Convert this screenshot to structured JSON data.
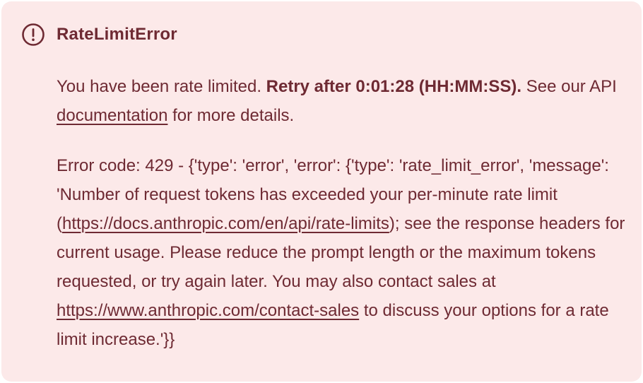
{
  "alert": {
    "icon": "exclamation-circle-icon",
    "colors": {
      "background": "#fce9e9",
      "text": "#6e2a33"
    },
    "title": "RateLimitError",
    "message": {
      "intro": "You have been rate limited. ",
      "retry": "Retry after 0:01:28 (HH:MM:SS).",
      "see_before_link": " See our API ",
      "doc_link": "documentation",
      "after_link": " for more details."
    },
    "details": {
      "text_1": "Error code: 429 - {'type': 'error', 'error': {'type': 'rate_limit_error', 'message': 'Number of request tokens has exceeded your per-minute rate limit (",
      "link_1": "https://docs.anthropic.com/en/api/rate-limits",
      "text_2": "); see the response headers for current usage. Please reduce the prompt length or the maximum tokens requested, or try again later. You may also contact sales at ",
      "link_2": "https://www.anthropic.com/contact-sales",
      "text_3": " to discuss your options for a rate limit increase.'}}"
    }
  }
}
